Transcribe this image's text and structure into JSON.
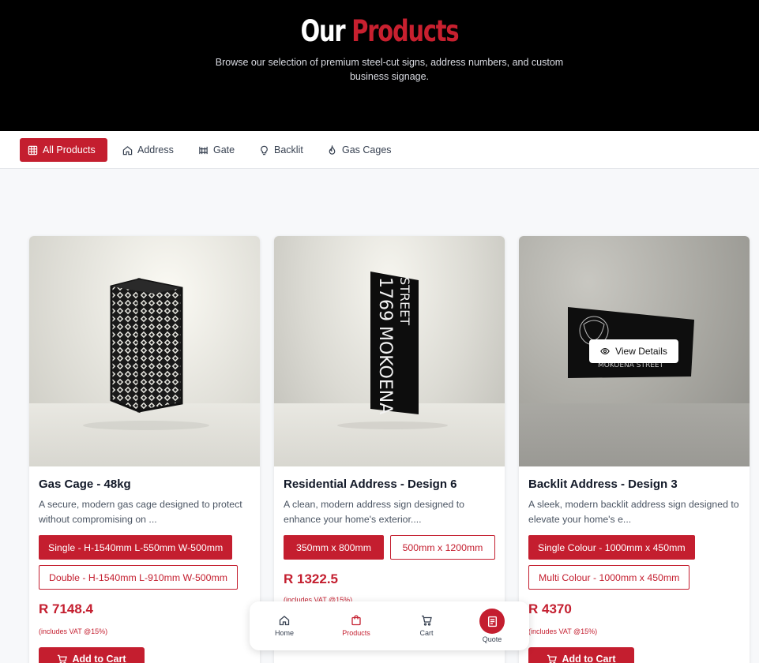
{
  "hero": {
    "title_white": "Our",
    "title_red": "Products",
    "subtitle": "Browse our selection of premium steel-cut signs, address numbers, and custom business signage."
  },
  "filters": [
    {
      "label": "All Products",
      "icon": "grid-icon",
      "active": true
    },
    {
      "label": "Address",
      "icon": "home-icon",
      "active": false
    },
    {
      "label": "Gate",
      "icon": "gate-icon",
      "active": false
    },
    {
      "label": "Backlit",
      "icon": "lightbulb-icon",
      "active": false
    },
    {
      "label": "Gas Cages",
      "icon": "flame-icon",
      "active": false
    }
  ],
  "products": [
    {
      "title": "Gas Cage - 48kg",
      "description": "A secure, modern gas cage designed to protect without compromising on ...",
      "options": [
        "Single - H-1540mm L-550mm W-500mm",
        "Double - H-1540mm L-910mm W-500mm"
      ],
      "selected_option": 0,
      "price": "R 7148.4",
      "vat": "(includes VAT @15%)",
      "cart_label": "Add to Cart"
    },
    {
      "title": "Residential Address - Design 6",
      "description": "A clean, modern address sign designed to enhance your home's exterior....",
      "options": [
        "350mm x 800mm",
        "500mm x 1200mm"
      ],
      "selected_option": 0,
      "price": "R 1322.5",
      "vat": "(includes VAT @15%)",
      "sign_number": "1769",
      "sign_street": "MOKOENA",
      "sign_street2": "STREET"
    },
    {
      "title": "Backlit Address - Design 3",
      "description": "A sleek, modern backlit address sign designed to elevate your home's e...",
      "options": [
        "Single Colour - 1000mm x 450mm",
        "Multi Colour - 1000mm x 450mm"
      ],
      "selected_option": 0,
      "price": "R 4370",
      "vat": "(includes VAT @15%)",
      "cart_label": "Add to Cart",
      "overlay_label": "View Details",
      "sign_text": "MOKOENA STREET"
    }
  ],
  "bottom_nav": [
    {
      "label": "Home",
      "icon": "home-icon",
      "active": false
    },
    {
      "label": "Products",
      "icon": "shopping-bag-icon",
      "active": true
    },
    {
      "label": "Cart",
      "icon": "cart-icon",
      "active": false
    },
    {
      "label": "Quote",
      "icon": "document-icon",
      "active": false
    }
  ],
  "colors": {
    "accent": "#c41e2f",
    "hero_bg": "#000000"
  }
}
